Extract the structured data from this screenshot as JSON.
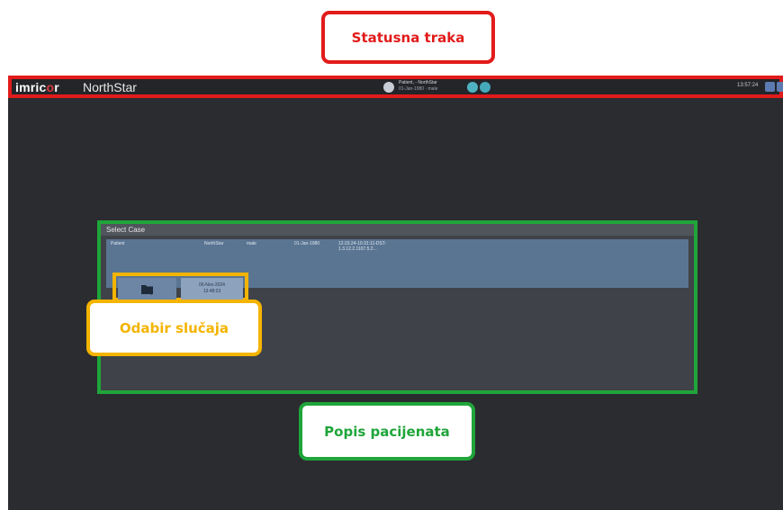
{
  "callouts": {
    "status_bar": "Statusna traka",
    "case_selection": "Odabir slučaja",
    "patient_list": "Popis pacijenata"
  },
  "status_bar": {
    "logo_prefix": "imric",
    "logo_o": "o",
    "logo_suffix": "r",
    "app_name": "NorthStar",
    "patient_line1": "Patient, - NorthStar",
    "patient_line2": "01-Jan-1980 · male",
    "time": "13:57:24"
  },
  "select_case": {
    "title": "Select Case",
    "case": {
      "name": "Patient",
      "institution": "NorthStar",
      "sex": "male",
      "dob": "01-Jan-1980",
      "id": "12.03.24-10:31:11-DST-1.3.12.2.1107.5.2..."
    },
    "study": {
      "date": "06-Nov-2024",
      "time": "13:48:23"
    }
  },
  "colors": {
    "red": "#e21b1b",
    "yellow": "#f4b400",
    "green": "#1fa53a",
    "app_bg": "#2b2c2f"
  }
}
